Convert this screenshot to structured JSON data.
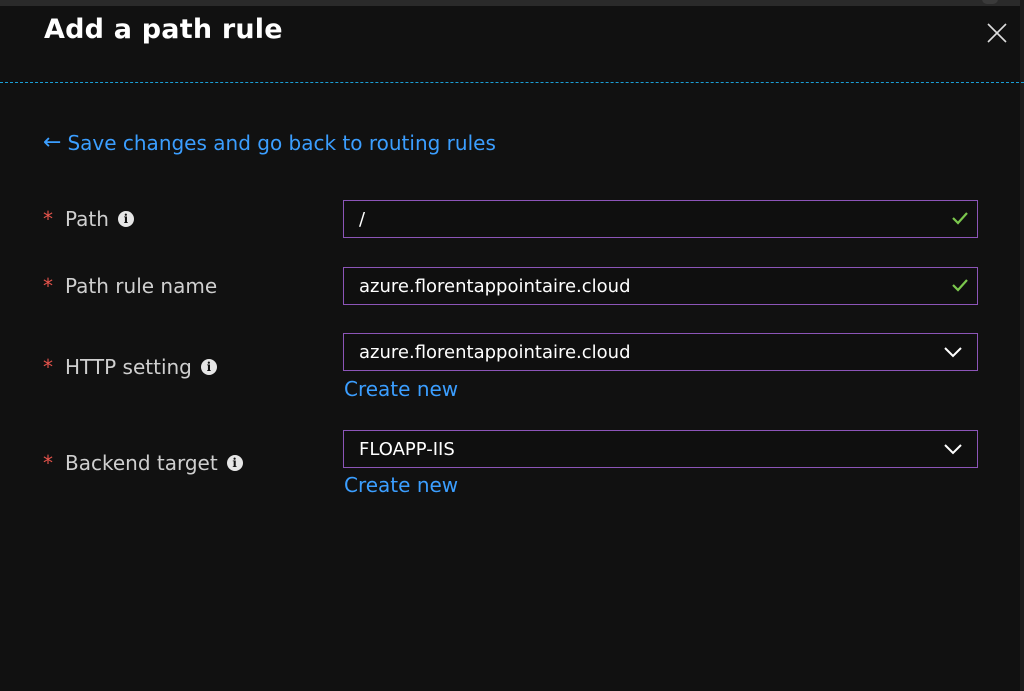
{
  "panel": {
    "title": "Add a path rule",
    "back_link": "Save changes and go back to routing rules",
    "back_arrow": "←"
  },
  "fields": {
    "path": {
      "required_marker": "*",
      "label": "Path",
      "info_glyph": "i",
      "value": "/",
      "valid": true
    },
    "path_rule_name": {
      "required_marker": "*",
      "label": "Path rule name",
      "value": "azure.florentappointaire.cloud",
      "valid": true
    },
    "http_setting": {
      "required_marker": "*",
      "label": "HTTP setting",
      "info_glyph": "i",
      "selected": "azure.florentappointaire.cloud",
      "create_new": "Create new"
    },
    "backend_target": {
      "required_marker": "*",
      "label": "Backend target",
      "info_glyph": "i",
      "selected": "FLOAPP-IIS",
      "create_new": "Create new"
    }
  },
  "colors": {
    "background": "#111111",
    "link": "#3b9eff",
    "required": "#e5534b",
    "field_border": "#8c55b8",
    "valid_check": "#7bc74d",
    "divider": "#1a9fd6"
  },
  "icons": {
    "close": "close-icon",
    "back": "arrow-left-icon",
    "info": "info-icon",
    "check": "checkmark-icon",
    "dropdown": "chevron-down-icon"
  }
}
